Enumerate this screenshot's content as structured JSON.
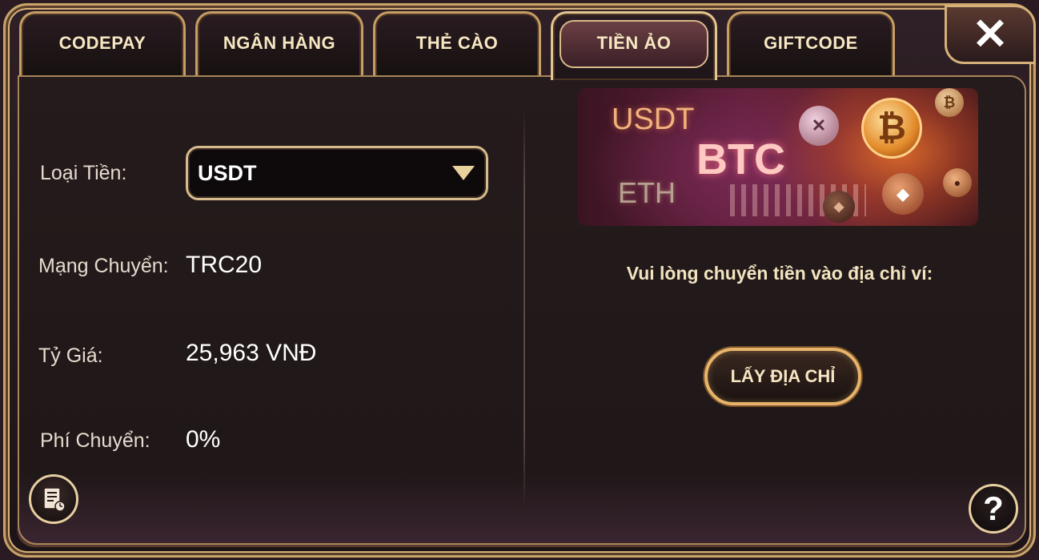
{
  "tabs": [
    {
      "label": "CODEPAY",
      "active": false
    },
    {
      "label": "NGÂN HÀNG",
      "active": false
    },
    {
      "label": "THẺ CÀO",
      "active": false
    },
    {
      "label": "TIỀN ẢO",
      "active": true
    },
    {
      "label": "GIFTCODE",
      "active": false
    }
  ],
  "close": {
    "glyph": "✕",
    "icon": "close-icon"
  },
  "form": {
    "currency_label": "Loại Tiền:",
    "currency_value": "USDT",
    "network_label": "Mạng Chuyển:",
    "network_value": "TRC20",
    "rate_label": "Tỷ Giá:",
    "rate_value": "25,963 VNĐ",
    "fee_label": "Phí Chuyển:",
    "fee_value": "0%"
  },
  "banner": {
    "usdt": "USDT",
    "btc": "BTC",
    "eth": "ETH",
    "btc_symbol": "₿"
  },
  "instruction": "Vui lòng chuyển tiền vào địa chỉ ví:",
  "get_address_label": "LẤY ĐỊA CHỈ",
  "help": {
    "glyph": "?",
    "icon": "help-icon"
  },
  "history": {
    "icon": "history-icon"
  },
  "colors": {
    "gold": "#d6bb8c",
    "panel": "#1f1718",
    "text": "#f3e4c0"
  }
}
